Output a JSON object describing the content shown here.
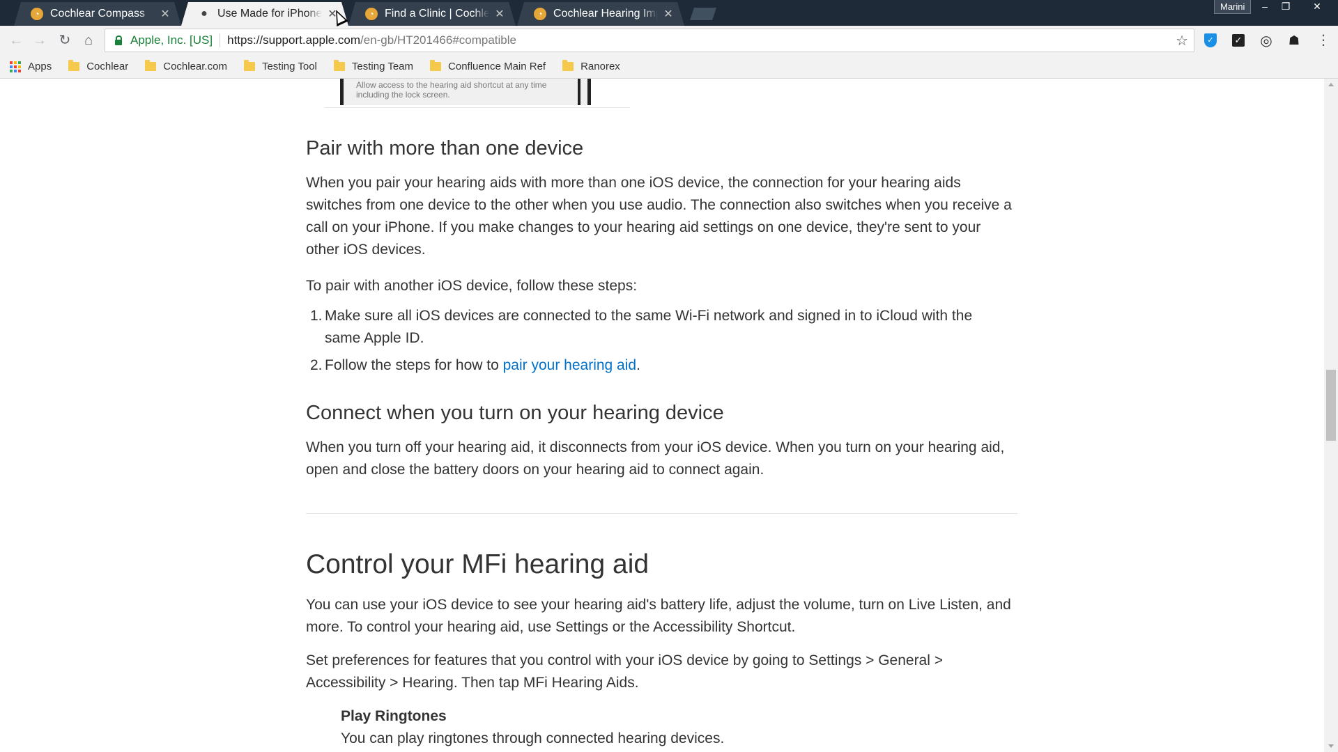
{
  "browser": {
    "tabs": [
      {
        "title": "Cochlear Compass",
        "favicon": "cochlear-favicon",
        "active": false
      },
      {
        "title": "Use Made for iPhone hearing aids - Apple Support",
        "favicon": "apple-favicon",
        "active": true
      },
      {
        "title": "Find a Clinic | Cochlear UK",
        "favicon": "cochlear-favicon",
        "active": false
      },
      {
        "title": "Cochlear Hearing Implants",
        "favicon": "cochlear-favicon",
        "active": false
      }
    ],
    "profile_name": "Marini",
    "window_controls": {
      "minimize": "–",
      "restore": "❐",
      "close": "✕"
    },
    "address": {
      "org": "Apple, Inc. [US]",
      "url_host": "https://support.apple.com",
      "url_path": "/en-gb/HT201466#compatible"
    },
    "bookmarks": [
      {
        "label": "Apps",
        "icon": "apps-grid-icon"
      },
      {
        "label": "Cochlear",
        "icon": "folder-icon"
      },
      {
        "label": "Cochlear.com",
        "icon": "folder-icon"
      },
      {
        "label": "Testing Tool",
        "icon": "folder-icon"
      },
      {
        "label": "Testing Team",
        "icon": "folder-icon"
      },
      {
        "label": "Confluence Main Ref",
        "icon": "folder-icon"
      },
      {
        "label": "Ranorex",
        "icon": "folder-icon"
      }
    ],
    "extensions": [
      "shield-extension-icon",
      "checkmark-extension-icon",
      "swirl-extension-icon",
      "person-extension-icon"
    ]
  },
  "content": {
    "screenshot_caption": "Allow access to the hearing aid shortcut at any time including the lock screen.",
    "pair": {
      "heading": "Pair with more than one device",
      "para1": "When you pair your hearing aids with more than one iOS device, the connection for your hearing aids switches from one device to the other when you use audio. The connection also switches when you receive a call on your iPhone. If you make changes to your hearing aid settings on one device, they're sent to your other iOS devices.",
      "para2": "To pair with another iOS device, follow these steps:",
      "steps": [
        {
          "num": "1.",
          "text": "Make sure all iOS devices are connected to the same Wi-Fi network and signed in to iCloud with the same Apple ID."
        },
        {
          "num": "2.",
          "text_before": "Follow the steps for how to ",
          "link": "pair your hearing aid",
          "text_after": "."
        }
      ]
    },
    "connect": {
      "heading": "Connect when you turn on your hearing device",
      "para": "When you turn off your hearing aid, it disconnects from your iOS device. When you turn on your hearing aid, open and close the battery doors on your hearing aid to connect again."
    },
    "control": {
      "heading": "Control your MFi hearing aid",
      "para1": "You can use your iOS device to see your hearing aid's battery life, adjust the volume, turn on Live Listen, and more. To control your hearing aid, use Settings or the Accessibility Shortcut.",
      "para2": "Set preferences for features that you control with your iOS device by going to Settings > General > Accessibility > Hearing. Then tap MFi Hearing Aids.",
      "feature_title": "Play Ringtones",
      "feature_body": "You can play ringtones through connected hearing devices."
    }
  },
  "colors": {
    "link": "#0070c9",
    "secure": "#188038",
    "tabstrip": "#1f2a38",
    "text": "#333333"
  },
  "apps_grid_colors": [
    "#ea4335",
    "#fbbc05",
    "#34a853",
    "#4285f4",
    "#ea4335",
    "#fbbc05",
    "#34a853",
    "#4285f4",
    "#ea4335"
  ]
}
